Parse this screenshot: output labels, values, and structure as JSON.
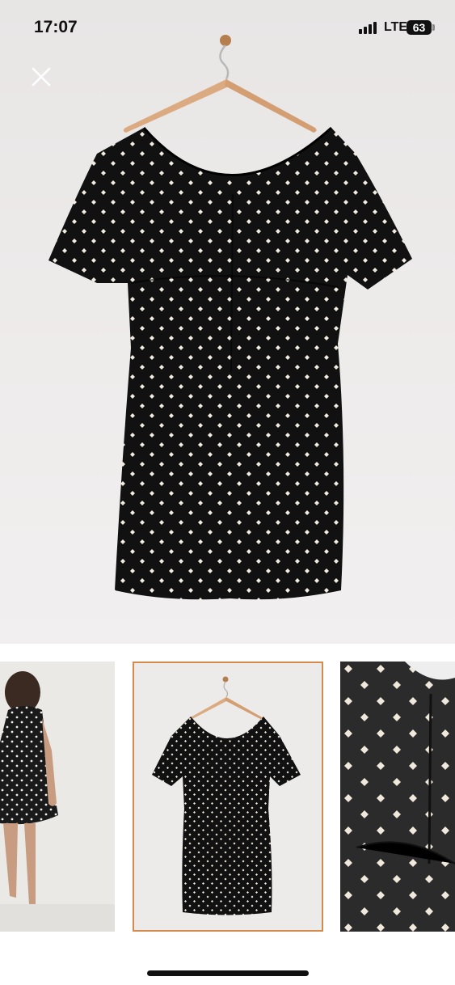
{
  "status_bar": {
    "time": "17:07",
    "network": "LTE",
    "battery": "63"
  },
  "icons": {
    "close": "close-icon",
    "signal": "cellular-signal-icon",
    "battery": "battery-icon"
  },
  "colors": {
    "dress": "#111111",
    "dots": "#f3ece0",
    "hanger": "#d8a47a",
    "selected_thumb_border": "#d58a4d"
  },
  "gallery": {
    "thumbnails": [
      "back-view-model",
      "front-on-hanger",
      "fabric-closeup"
    ],
    "selected": 1
  }
}
